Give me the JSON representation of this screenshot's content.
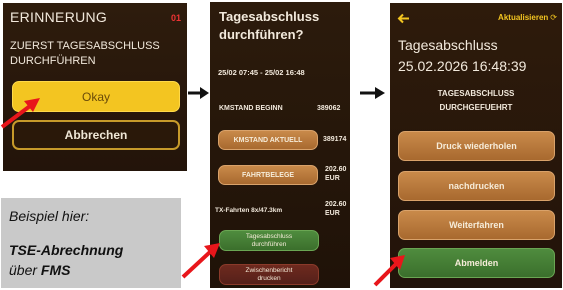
{
  "screen1": {
    "title": "ERINNERUNG",
    "counter": "01",
    "message_line1": "ZUERST TAGESABSCHLUSS",
    "message_line2": "DURCHFÜHREN",
    "okay_label": "Okay",
    "cancel_label": "Abbrechen"
  },
  "screen2": {
    "title_line1": "Tagesabschluss",
    "title_line2": "durchführen?",
    "date_range": "25/02 07:45 - 25/02 16:48",
    "km_begin_label": "KMSTAND BEGINN",
    "km_begin_value": "389062",
    "km_current_label": "KMSTAND AKTUELL",
    "km_current_value": "389174",
    "receipts_label": "FAHRTBELEGE",
    "receipts_amount": "202.60",
    "receipts_currency": "EUR",
    "tx_label": "TX-Fahrten 8x/47.3km",
    "tx_amount": "202.60",
    "tx_currency": "EUR",
    "close_day_line1": "Tagesabschluss",
    "close_day_line2": "durchführen",
    "interim_line1": "Zwischenbericht",
    "interim_line2": "drucken"
  },
  "screen3": {
    "refresh_label": "Aktualisieren",
    "title": "Tagesabschluss",
    "datetime": "25.02.2026 16:48:39",
    "status_line1": "TAGESABSCHLUSS",
    "status_line2": "DURCHGEFUEHRT",
    "reprint_label": "Druck wiederholen",
    "print_later_label": "nachdrucken",
    "continue_label": "Weiterfahren",
    "logout_label": "Abmelden"
  },
  "note": {
    "line1": "Beispiel hier:",
    "line2a": "TSE-Abrechnung",
    "line3a": "über ",
    "line3b": "FMS"
  },
  "colors": {
    "accent_yellow": "#f3c521",
    "brown_button": "#b87a3d",
    "green_button": "#457d35",
    "annotation_red": "#e8161b"
  }
}
